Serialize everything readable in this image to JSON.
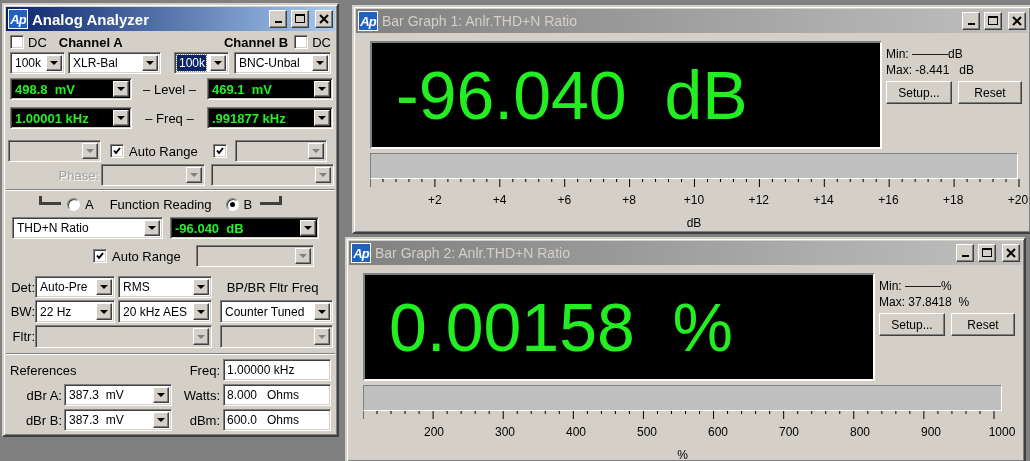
{
  "analyzer": {
    "logo": "Ap",
    "title": "Analog Analyzer",
    "active": true,
    "channels": [
      {
        "name": "Channel A",
        "dc_label": "DC",
        "dc_checked": false,
        "range": "100k",
        "range_focused": false,
        "input": "XLR-Bal",
        "level": "498.8  mV",
        "freq": "1.00001 kHz"
      },
      {
        "name": "Channel B",
        "dc_label": "DC",
        "dc_checked": false,
        "range": "100k",
        "range_focused": true,
        "input": "BNC-Unbal",
        "level": "469.1  mV",
        "freq": ".991877 kHz"
      }
    ],
    "level_label": "– Level –",
    "freq_label": "– Freq –",
    "auto_range": {
      "label": "Auto Range",
      "checked": true
    },
    "auto_range_b_checked": true,
    "phase_label": "Phase:",
    "function_reading": {
      "label": "Function Reading",
      "options": [
        {
          "label": "A",
          "selected": false
        },
        {
          "label": "B",
          "selected": true
        }
      ],
      "function": "THD+N Ratio",
      "reading": "-96.040  dB",
      "auto_range": {
        "label": "Auto Range",
        "checked": true
      }
    },
    "detector": {
      "label": "Det:",
      "mode": "Auto-Pre",
      "type": "RMS"
    },
    "bandwidth": {
      "label": "BW:",
      "low": "22 Hz",
      "high": "20 kHz AES"
    },
    "filter_freq": {
      "label": "BP/BR Fltr Freq",
      "value": "Counter Tuned"
    },
    "filter_label": "Fltr:",
    "references": {
      "title": "References",
      "left_fields": [
        {
          "label": "dBr A:",
          "value": "387.3  mV"
        },
        {
          "label": "dBr B:",
          "value": "387.3  mV"
        }
      ],
      "right_fields": [
        {
          "label": "Freq:",
          "value": "1.00000 kHz"
        },
        {
          "label": "Watts:",
          "value": "8.000   Ohms"
        },
        {
          "label": "dBm:",
          "value": "600.0   Ohms"
        }
      ]
    }
  },
  "bar_graphs": [
    {
      "logo": "Ap",
      "title": "Bar Graph 1: Anlr.THD+N Ratio",
      "active": false,
      "reading": "-96.040  dB",
      "min": "Min: ———dB",
      "max": "Max: -8.441   dB",
      "buttons": [
        "Setup...",
        "Reset"
      ],
      "scale": [
        "+2",
        "+4",
        "+6",
        "+8",
        "+10",
        "+12",
        "+14",
        "+16",
        "+18",
        "+20"
      ],
      "unit": "dB"
    },
    {
      "logo": "Ap",
      "title": "Bar Graph 2: Anlr.THD+N Ratio",
      "active": false,
      "reading": "0.00158  %",
      "min": "Min: ———%",
      "max": "Max: 37.8418  %",
      "buttons": [
        "Setup...",
        "Reset"
      ],
      "scale": [
        "200",
        "300",
        "400",
        "500",
        "600",
        "700",
        "800",
        "900",
        "1000"
      ],
      "unit": "%"
    }
  ]
}
